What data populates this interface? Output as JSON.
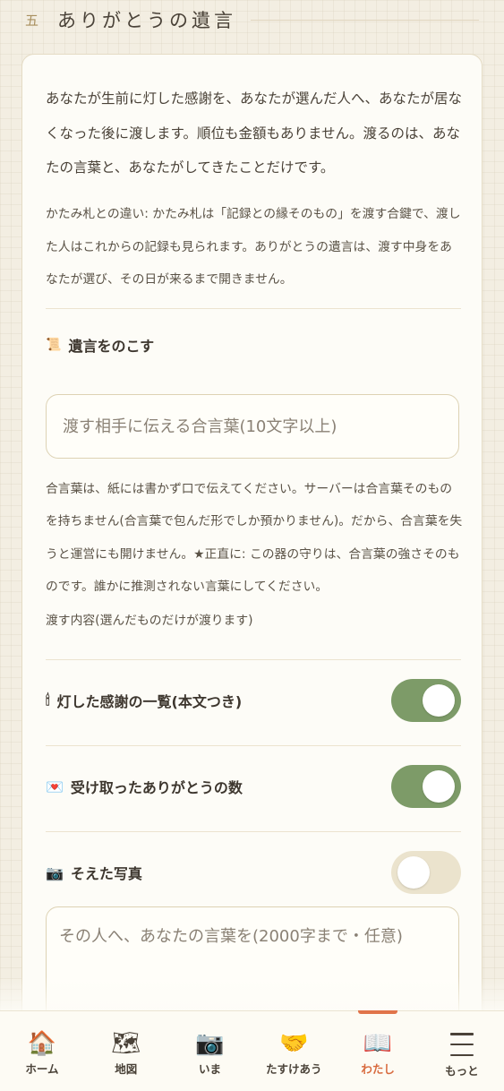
{
  "section": {
    "number": "五",
    "title": "ありがとうの遺言"
  },
  "intro": "あなたが生前に灯した感謝を、あなたが選んだ人へ、あなたが居なくなった後に渡します。順位も金額もありません。渡るのは、あなたの言葉と、あなたがしてきたことだけです。",
  "note": "かたみ札との違い: かたみ札は「記録との縁そのもの」を渡す合鍵で、渡した人はこれからの記録も見られます。ありがとうの遺言は、渡す中身をあなたが選び、その日が来るまで開きません。",
  "leave": {
    "icon": "📜",
    "icon_name": "scroll-icon",
    "label": "遺言をのこす"
  },
  "passphrase": {
    "value": "",
    "placeholder": "渡す相手に伝える合言葉(10文字以上)"
  },
  "help": "合言葉は、紙には書かず口で伝えてください。サーバーは合言葉そのものを持ちません(合言葉で包んだ形でしか預かりません)。だから、合言葉を失うと運営にも開けません。★正直に: この器の守りは、合言葉の強さそのものです。誰かに推測されない言葉にしてください。",
  "contents_label": "渡す内容(選んだものだけが渡ります)",
  "toggles": [
    {
      "icon": "🕯",
      "icon_name": "candle-icon",
      "label": "灯した感謝の一覧(本文つき)",
      "state": "on"
    },
    {
      "icon": "💌",
      "icon_name": "love-letter-icon",
      "label": "受け取ったありがとうの数",
      "state": "on"
    },
    {
      "icon": "📷",
      "icon_name": "camera-icon",
      "label": "そえた写真",
      "state": "off"
    }
  ],
  "message": {
    "value": "",
    "placeholder": "その人へ、あなたの言葉を(2000字まで・任意)"
  },
  "nav": {
    "items": [
      {
        "icon": "🏠",
        "icon_name": "home-icon",
        "label": "ホーム",
        "active": false
      },
      {
        "icon": "🗺",
        "icon_name": "world-map-icon",
        "label": "地図",
        "active": false
      },
      {
        "icon": "📷",
        "icon_name": "camera-icon",
        "label": "いま",
        "active": false
      },
      {
        "icon": "🤝",
        "icon_name": "handshake-icon",
        "label": "たすけあう",
        "active": false
      },
      {
        "icon": "📖",
        "icon_name": "open-book-icon",
        "label": "わたし",
        "active": true
      },
      {
        "icon": "☰",
        "icon_name": "menu-icon",
        "label": "もっと",
        "active": false
      }
    ],
    "accent": "#e0744a"
  },
  "colors": {
    "toggle_on": "#7d9b68",
    "toggle_off": "#ebe3cd",
    "card_bg": "#fdfcf7",
    "page_bg": "#f3eee2"
  }
}
